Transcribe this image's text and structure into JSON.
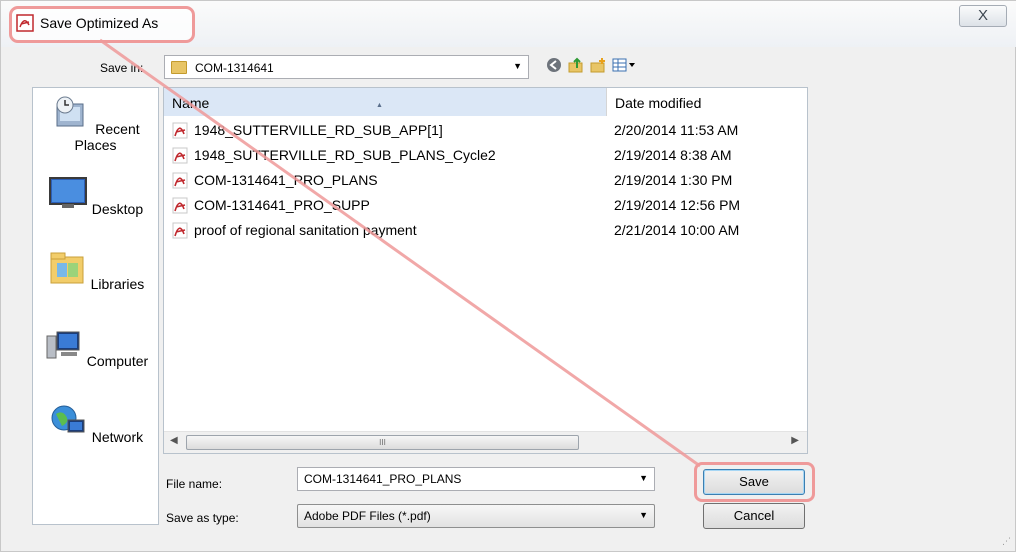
{
  "window": {
    "title": "Save Optimized As",
    "close_glyph": "X"
  },
  "toolbar": {
    "save_in_label": "Save in:",
    "save_in_value": "COM-1314641",
    "icons": [
      "back-icon",
      "up-folder-icon",
      "new-folder-icon",
      "view-menu-icon"
    ]
  },
  "places": [
    {
      "label": "Recent Places",
      "icon": "recent-places-icon"
    },
    {
      "label": "Desktop",
      "icon": "desktop-icon"
    },
    {
      "label": "Libraries",
      "icon": "libraries-icon"
    },
    {
      "label": "Computer",
      "icon": "computer-icon"
    },
    {
      "label": "Network",
      "icon": "network-icon"
    }
  ],
  "file_list": {
    "columns": [
      "Name",
      "Date modified"
    ],
    "rows": [
      {
        "name": "1948_SUTTERVILLE_RD_SUB_APP[1]",
        "date": "2/20/2014 11:53 AM"
      },
      {
        "name": "1948_SUTTERVILLE_RD_SUB_PLANS_Cycle2",
        "date": "2/19/2014 8:38 AM"
      },
      {
        "name": "COM-1314641_PRO_PLANS",
        "date": "2/19/2014 1:30 PM"
      },
      {
        "name": "COM-1314641_PRO_SUPP",
        "date": "2/19/2014 12:56 PM"
      },
      {
        "name": "proof of regional sanitation payment",
        "date": "2/21/2014 10:00 AM"
      }
    ],
    "scroll_thumb_glyph": "III"
  },
  "form": {
    "file_name_label": "File name:",
    "file_name_value": "COM-1314641_PRO_PLANS",
    "save_as_type_label": "Save as type:",
    "save_as_type_value": "Adobe PDF Files (*.pdf)"
  },
  "buttons": {
    "save": "Save",
    "cancel": "Cancel"
  },
  "colors": {
    "highlight": "#ef9a9a",
    "list_header_selected": "#dbe7f6",
    "pdf_red": "#c0282d"
  }
}
